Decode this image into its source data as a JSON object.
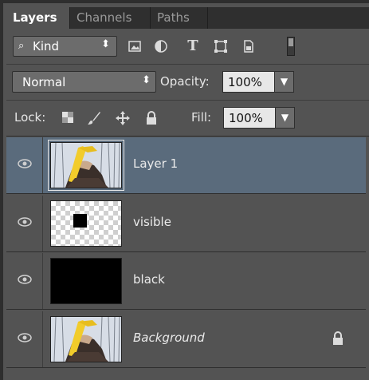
{
  "tabs": [
    {
      "label": "Layers",
      "active": true
    },
    {
      "label": "Channels",
      "active": false
    },
    {
      "label": "Paths",
      "active": false
    }
  ],
  "filter": {
    "kind_label": "Kind",
    "icons": [
      "image-filter-icon",
      "adjustment-filter-icon",
      "type-filter-icon",
      "shape-filter-icon",
      "smart-object-filter-icon"
    ],
    "toggle": "filter-toggle"
  },
  "blend": {
    "mode": "Normal",
    "opacity_label": "Opacity:",
    "opacity_value": "100%"
  },
  "lock": {
    "label": "Lock:",
    "fill_label": "Fill:",
    "fill_value": "100%"
  },
  "layers": [
    {
      "name": "Layer 1",
      "selected": true,
      "italic": false,
      "thumb": "photo",
      "locked": false
    },
    {
      "name": "visible",
      "selected": false,
      "italic": false,
      "thumb": "checker-square",
      "locked": false
    },
    {
      "name": "black",
      "selected": false,
      "italic": false,
      "thumb": "solid-black",
      "locked": false
    },
    {
      "name": "Background",
      "selected": false,
      "italic": true,
      "thumb": "photo",
      "locked": true
    }
  ],
  "colors": {
    "panel": "#535353",
    "selected_row": "#5a6b7c",
    "field": "#e7e7e7"
  }
}
